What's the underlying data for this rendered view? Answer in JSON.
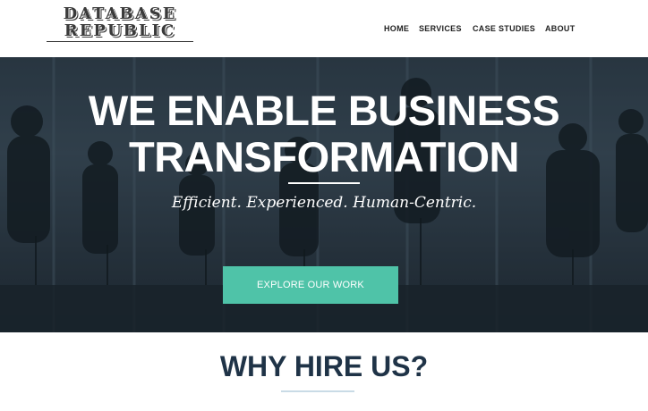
{
  "brand": {
    "line1": "DATABASE",
    "line2": "REPUBLIC"
  },
  "nav": [
    {
      "label": "HOME"
    },
    {
      "label": "SERVICES"
    },
    {
      "label": "CASE STUDIES"
    },
    {
      "label": "ABOUT"
    }
  ],
  "hero": {
    "title_line1": "WE ENABLE BUSINESS",
    "title_line2": "TRANSFORMATION",
    "tagline": "Efficient. Experienced. Human-Centric.",
    "cta_label": "EXPLORE OUR WORK"
  },
  "section": {
    "title": "WHY HIRE US?"
  },
  "colors": {
    "accent": "#4fc3a8",
    "heading": "#1f3347",
    "hero_overlay": "#2f3d49"
  }
}
